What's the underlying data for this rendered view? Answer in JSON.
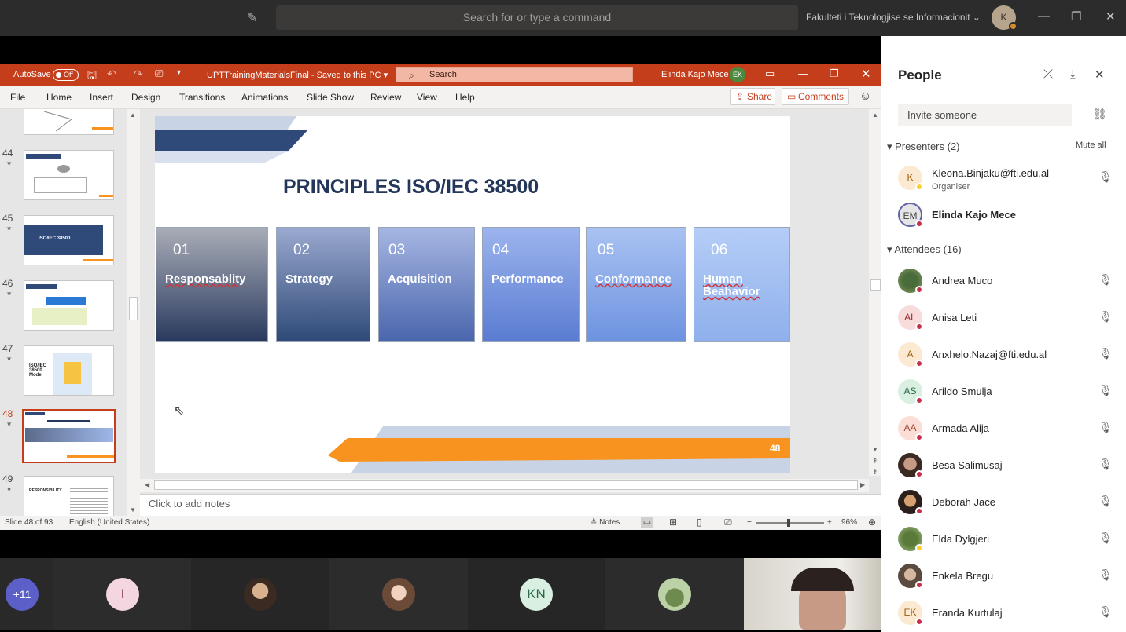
{
  "teams": {
    "search_placeholder": "Search for or type a command",
    "org": "Fakulteti i Teknologjise se Informacionit",
    "avatar": "K"
  },
  "ppt": {
    "autosave": "AutoSave",
    "autosave_state": "Off",
    "filename": "UPTTrainingMaterialsFinal  -  Saved to this PC",
    "search": "Search",
    "user": "Elinda Kajo Mece",
    "user_initials": "EK",
    "tabs": [
      "File",
      "Home",
      "Insert",
      "Design",
      "Transitions",
      "Animations",
      "Slide Show",
      "Review",
      "View",
      "Help"
    ],
    "share": "Share",
    "comments": "Comments"
  },
  "thumbnails": [
    {
      "num": "44"
    },
    {
      "num": "45",
      "text": "ISO/IEC 38500"
    },
    {
      "num": "46"
    },
    {
      "num": "47",
      "text": "ISO/IEC 38500 Model"
    },
    {
      "num": "48"
    },
    {
      "num": "49",
      "text": "RESPONSIBILITY"
    }
  ],
  "slide": {
    "title": "PRINCIPLES ISO/IEC 38500",
    "cards": [
      {
        "num": "01",
        "label": "Responsablity"
      },
      {
        "num": "02",
        "label": "Strategy"
      },
      {
        "num": "03",
        "label": "Acquisition"
      },
      {
        "num": "04",
        "label": "Performance"
      },
      {
        "num": "05",
        "label": "Conformance"
      },
      {
        "num": "06",
        "label": "Human Beahavior"
      }
    ],
    "page": "48"
  },
  "notes_placeholder": "Click to add notes",
  "status": {
    "slide": "Slide 48 of 93",
    "language": "English (United States)",
    "notes": "Notes",
    "zoom": "96%"
  },
  "videos": [
    {
      "label": "+11"
    },
    {
      "label": "I"
    },
    {
      "label": ""
    },
    {
      "label": ""
    },
    {
      "label": "KN"
    },
    {
      "label": ""
    }
  ],
  "people": {
    "title": "People",
    "invite": "Invite someone",
    "presenters_label": "Presenters (2)",
    "mute_all": "Mute all",
    "presenters": [
      {
        "initials": "K",
        "name": "Kleona.Binjaku@fti.edu.al",
        "role": "Organiser"
      },
      {
        "initials": "EM",
        "name": "Elinda Kajo Mece"
      }
    ],
    "attendees_label": "Attendees (16)",
    "attendees": [
      {
        "initials": "",
        "name": "Andrea Muco"
      },
      {
        "initials": "AL",
        "name": "Anisa Leti"
      },
      {
        "initials": "A",
        "name": "Anxhelo.Nazaj@fti.edu.al"
      },
      {
        "initials": "AS",
        "name": "Arildo Smulja"
      },
      {
        "initials": "AA",
        "name": "Armada Alija"
      },
      {
        "initials": "",
        "name": "Besa Salimusaj"
      },
      {
        "initials": "",
        "name": "Deborah Jace"
      },
      {
        "initials": "",
        "name": "Elda Dylgjeri"
      },
      {
        "initials": "",
        "name": "Enkela Bregu"
      },
      {
        "initials": "EK",
        "name": "Eranda Kurtulaj"
      }
    ]
  }
}
